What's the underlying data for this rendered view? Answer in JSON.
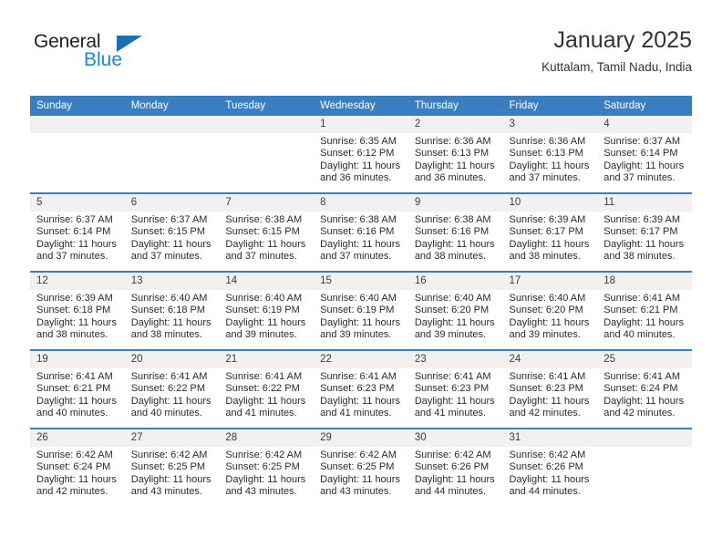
{
  "brand": {
    "name_top": "General",
    "name_bottom": "Blue",
    "triangle_color": "#1b6fb5",
    "blue_color": "#1b8ad6"
  },
  "header": {
    "title": "January 2025",
    "subtitle": "Kuttalam, Tamil Nadu, India"
  },
  "theme": {
    "header_bg": "#3a7ebf",
    "header_text": "#ffffff",
    "daynum_bg": "#f1f1f1",
    "cell_bg": "#ffffff",
    "text": "#2b2b2b"
  },
  "weekday_headers": [
    "Sunday",
    "Monday",
    "Tuesday",
    "Wednesday",
    "Thursday",
    "Friday",
    "Saturday"
  ],
  "weeks": [
    {
      "days": [
        {
          "num": "",
          "sunrise": "",
          "sunset": "",
          "daylight_line1": "",
          "daylight_line2": ""
        },
        {
          "num": "",
          "sunrise": "",
          "sunset": "",
          "daylight_line1": "",
          "daylight_line2": ""
        },
        {
          "num": "",
          "sunrise": "",
          "sunset": "",
          "daylight_line1": "",
          "daylight_line2": ""
        },
        {
          "num": "1",
          "sunrise": "Sunrise: 6:35 AM",
          "sunset": "Sunset: 6:12 PM",
          "daylight_line1": "Daylight: 11 hours",
          "daylight_line2": "and 36 minutes."
        },
        {
          "num": "2",
          "sunrise": "Sunrise: 6:36 AM",
          "sunset": "Sunset: 6:13 PM",
          "daylight_line1": "Daylight: 11 hours",
          "daylight_line2": "and 36 minutes."
        },
        {
          "num": "3",
          "sunrise": "Sunrise: 6:36 AM",
          "sunset": "Sunset: 6:13 PM",
          "daylight_line1": "Daylight: 11 hours",
          "daylight_line2": "and 37 minutes."
        },
        {
          "num": "4",
          "sunrise": "Sunrise: 6:37 AM",
          "sunset": "Sunset: 6:14 PM",
          "daylight_line1": "Daylight: 11 hours",
          "daylight_line2": "and 37 minutes."
        }
      ]
    },
    {
      "days": [
        {
          "num": "5",
          "sunrise": "Sunrise: 6:37 AM",
          "sunset": "Sunset: 6:14 PM",
          "daylight_line1": "Daylight: 11 hours",
          "daylight_line2": "and 37 minutes."
        },
        {
          "num": "6",
          "sunrise": "Sunrise: 6:37 AM",
          "sunset": "Sunset: 6:15 PM",
          "daylight_line1": "Daylight: 11 hours",
          "daylight_line2": "and 37 minutes."
        },
        {
          "num": "7",
          "sunrise": "Sunrise: 6:38 AM",
          "sunset": "Sunset: 6:15 PM",
          "daylight_line1": "Daylight: 11 hours",
          "daylight_line2": "and 37 minutes."
        },
        {
          "num": "8",
          "sunrise": "Sunrise: 6:38 AM",
          "sunset": "Sunset: 6:16 PM",
          "daylight_line1": "Daylight: 11 hours",
          "daylight_line2": "and 37 minutes."
        },
        {
          "num": "9",
          "sunrise": "Sunrise: 6:38 AM",
          "sunset": "Sunset: 6:16 PM",
          "daylight_line1": "Daylight: 11 hours",
          "daylight_line2": "and 38 minutes."
        },
        {
          "num": "10",
          "sunrise": "Sunrise: 6:39 AM",
          "sunset": "Sunset: 6:17 PM",
          "daylight_line1": "Daylight: 11 hours",
          "daylight_line2": "and 38 minutes."
        },
        {
          "num": "11",
          "sunrise": "Sunrise: 6:39 AM",
          "sunset": "Sunset: 6:17 PM",
          "daylight_line1": "Daylight: 11 hours",
          "daylight_line2": "and 38 minutes."
        }
      ]
    },
    {
      "days": [
        {
          "num": "12",
          "sunrise": "Sunrise: 6:39 AM",
          "sunset": "Sunset: 6:18 PM",
          "daylight_line1": "Daylight: 11 hours",
          "daylight_line2": "and 38 minutes."
        },
        {
          "num": "13",
          "sunrise": "Sunrise: 6:40 AM",
          "sunset": "Sunset: 6:18 PM",
          "daylight_line1": "Daylight: 11 hours",
          "daylight_line2": "and 38 minutes."
        },
        {
          "num": "14",
          "sunrise": "Sunrise: 6:40 AM",
          "sunset": "Sunset: 6:19 PM",
          "daylight_line1": "Daylight: 11 hours",
          "daylight_line2": "and 39 minutes."
        },
        {
          "num": "15",
          "sunrise": "Sunrise: 6:40 AM",
          "sunset": "Sunset: 6:19 PM",
          "daylight_line1": "Daylight: 11 hours",
          "daylight_line2": "and 39 minutes."
        },
        {
          "num": "16",
          "sunrise": "Sunrise: 6:40 AM",
          "sunset": "Sunset: 6:20 PM",
          "daylight_line1": "Daylight: 11 hours",
          "daylight_line2": "and 39 minutes."
        },
        {
          "num": "17",
          "sunrise": "Sunrise: 6:40 AM",
          "sunset": "Sunset: 6:20 PM",
          "daylight_line1": "Daylight: 11 hours",
          "daylight_line2": "and 39 minutes."
        },
        {
          "num": "18",
          "sunrise": "Sunrise: 6:41 AM",
          "sunset": "Sunset: 6:21 PM",
          "daylight_line1": "Daylight: 11 hours",
          "daylight_line2": "and 40 minutes."
        }
      ]
    },
    {
      "days": [
        {
          "num": "19",
          "sunrise": "Sunrise: 6:41 AM",
          "sunset": "Sunset: 6:21 PM",
          "daylight_line1": "Daylight: 11 hours",
          "daylight_line2": "and 40 minutes."
        },
        {
          "num": "20",
          "sunrise": "Sunrise: 6:41 AM",
          "sunset": "Sunset: 6:22 PM",
          "daylight_line1": "Daylight: 11 hours",
          "daylight_line2": "and 40 minutes."
        },
        {
          "num": "21",
          "sunrise": "Sunrise: 6:41 AM",
          "sunset": "Sunset: 6:22 PM",
          "daylight_line1": "Daylight: 11 hours",
          "daylight_line2": "and 41 minutes."
        },
        {
          "num": "22",
          "sunrise": "Sunrise: 6:41 AM",
          "sunset": "Sunset: 6:23 PM",
          "daylight_line1": "Daylight: 11 hours",
          "daylight_line2": "and 41 minutes."
        },
        {
          "num": "23",
          "sunrise": "Sunrise: 6:41 AM",
          "sunset": "Sunset: 6:23 PM",
          "daylight_line1": "Daylight: 11 hours",
          "daylight_line2": "and 41 minutes."
        },
        {
          "num": "24",
          "sunrise": "Sunrise: 6:41 AM",
          "sunset": "Sunset: 6:23 PM",
          "daylight_line1": "Daylight: 11 hours",
          "daylight_line2": "and 42 minutes."
        },
        {
          "num": "25",
          "sunrise": "Sunrise: 6:41 AM",
          "sunset": "Sunset: 6:24 PM",
          "daylight_line1": "Daylight: 11 hours",
          "daylight_line2": "and 42 minutes."
        }
      ]
    },
    {
      "days": [
        {
          "num": "26",
          "sunrise": "Sunrise: 6:42 AM",
          "sunset": "Sunset: 6:24 PM",
          "daylight_line1": "Daylight: 11 hours",
          "daylight_line2": "and 42 minutes."
        },
        {
          "num": "27",
          "sunrise": "Sunrise: 6:42 AM",
          "sunset": "Sunset: 6:25 PM",
          "daylight_line1": "Daylight: 11 hours",
          "daylight_line2": "and 43 minutes."
        },
        {
          "num": "28",
          "sunrise": "Sunrise: 6:42 AM",
          "sunset": "Sunset: 6:25 PM",
          "daylight_line1": "Daylight: 11 hours",
          "daylight_line2": "and 43 minutes."
        },
        {
          "num": "29",
          "sunrise": "Sunrise: 6:42 AM",
          "sunset": "Sunset: 6:25 PM",
          "daylight_line1": "Daylight: 11 hours",
          "daylight_line2": "and 43 minutes."
        },
        {
          "num": "30",
          "sunrise": "Sunrise: 6:42 AM",
          "sunset": "Sunset: 6:26 PM",
          "daylight_line1": "Daylight: 11 hours",
          "daylight_line2": "and 44 minutes."
        },
        {
          "num": "31",
          "sunrise": "Sunrise: 6:42 AM",
          "sunset": "Sunset: 6:26 PM",
          "daylight_line1": "Daylight: 11 hours",
          "daylight_line2": "and 44 minutes."
        },
        {
          "num": "",
          "sunrise": "",
          "sunset": "",
          "daylight_line1": "",
          "daylight_line2": ""
        }
      ]
    }
  ]
}
